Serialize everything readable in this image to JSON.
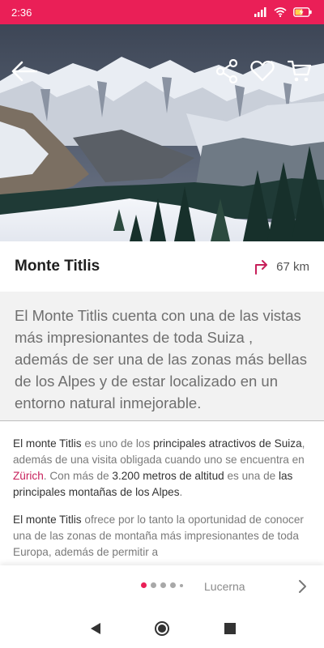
{
  "status": {
    "time": "2:36"
  },
  "place": {
    "title": "Monte Titlis",
    "distance": "67 km"
  },
  "intro": "El Monte Titlis cuenta con una de las vistas más impresionantes de toda Suiza , además de ser  una de las zonas más bellas de los Alpes  y de estar localizado en un entorno natural inmejorable.",
  "body": {
    "p1": [
      {
        "t": "El monte Titlis",
        "hl": true
      },
      {
        "t": " es uno de los ",
        "hl": false
      },
      {
        "t": "principales atractivos de Suiza",
        "hl": true
      },
      {
        "t": ", además de una visita obligada cuando uno se encuentra en ",
        "hl": false
      },
      {
        "t": "Zürich",
        "link": true
      },
      {
        "t": ". Con más de ",
        "hl": false
      },
      {
        "t": "3.200 metros de altitud",
        "hl": true
      },
      {
        "t": " es una de ",
        "hl": false
      },
      {
        "t": "las principales montañas de los Alpes",
        "hl": true
      },
      {
        "t": ".",
        "hl": false
      }
    ],
    "p2": [
      {
        "t": "El monte Titlis",
        "hl": true
      },
      {
        "t": " ofrece por lo tanto la oportunidad de conocer una de las zonas de montaña más impresionantes de toda Europa, además de permitir a",
        "hl": false
      }
    ]
  },
  "pager": {
    "next_label": "Lucerna"
  },
  "icons": {
    "back": "arrow-left-icon",
    "share": "share-icon",
    "favorite": "heart-icon",
    "cart": "cart-icon",
    "directions": "turn-right-arrow-icon"
  },
  "colors": {
    "accent": "#ea1f57"
  }
}
